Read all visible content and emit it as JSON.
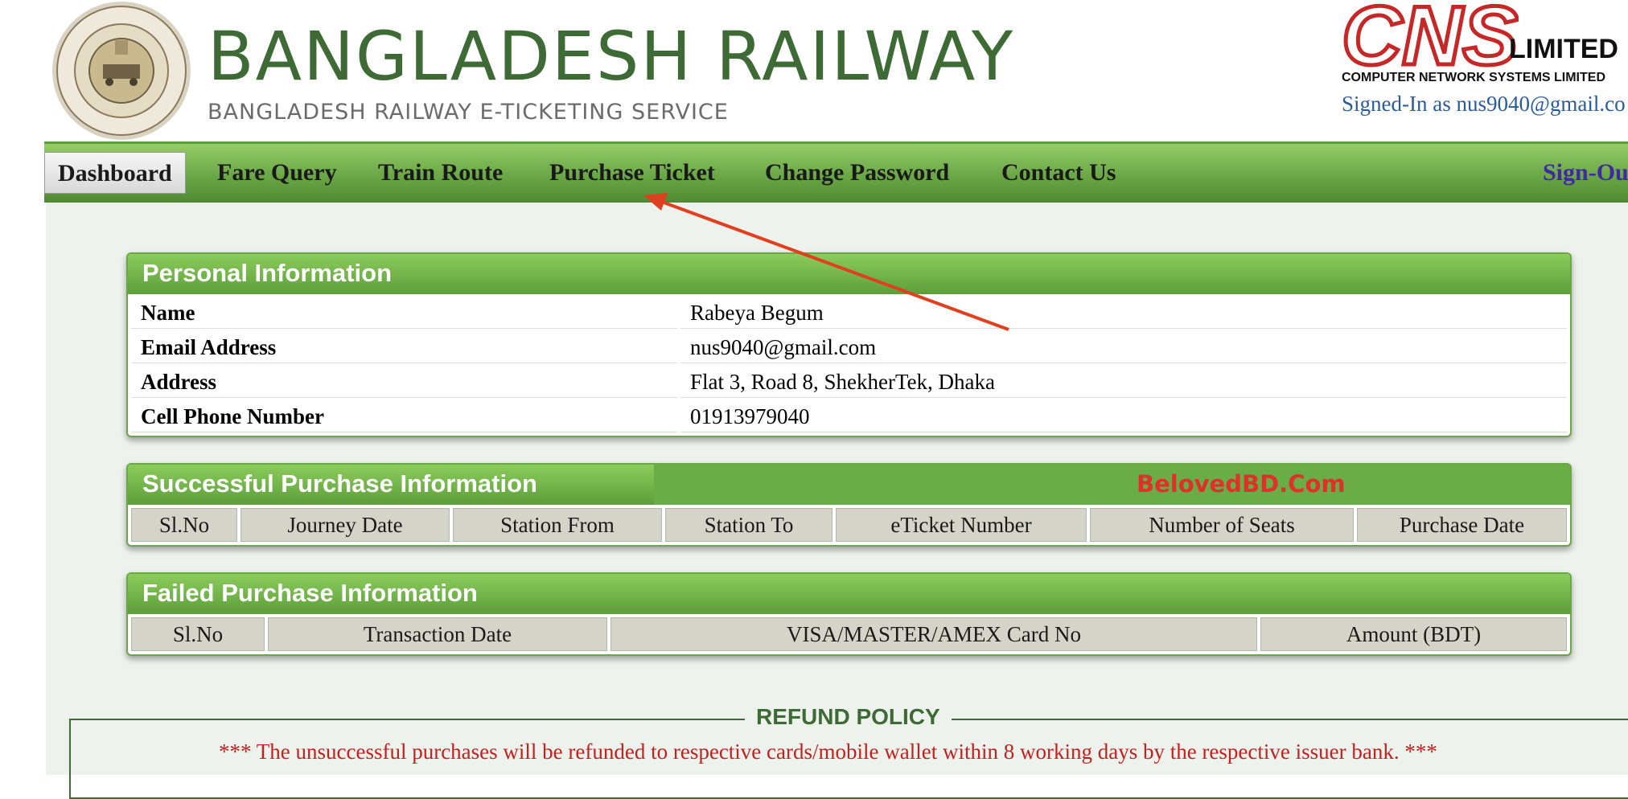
{
  "header": {
    "title": "BANGLADESH RAILWAY",
    "subtitle": "BANGLADESH RAILWAY E-TICKETING SERVICE",
    "partner": {
      "brand": "CNS",
      "limited": "LIMITED",
      "full_name": "COMPUTER NETWORK SYSTEMS LIMITED"
    },
    "signed_in": "Signed-In as nus9040@gmail.co"
  },
  "nav": {
    "items": [
      {
        "label": "Dashboard",
        "active": true
      },
      {
        "label": "Fare Query"
      },
      {
        "label": "Train Route"
      },
      {
        "label": "Purchase Ticket"
      },
      {
        "label": "Change Password"
      },
      {
        "label": "Contact Us"
      }
    ],
    "sign_out": "Sign-Ou"
  },
  "personal": {
    "title": "Personal Information",
    "rows": [
      {
        "label": "Name",
        "value": "Rabeya Begum"
      },
      {
        "label": "Email Address",
        "value": "nus9040@gmail.com"
      },
      {
        "label": "Address",
        "value": "Flat 3, Road 8, ShekherTek, Dhaka"
      },
      {
        "label": "Cell Phone Number",
        "value": "01913979040"
      }
    ]
  },
  "successful": {
    "title": "Successful Purchase Information",
    "watermark": "BelovedBD.Com",
    "columns": [
      "Sl.No",
      "Journey Date",
      "Station From",
      "Station To",
      "eTicket Number",
      "Number of Seats",
      "Purchase Date"
    ]
  },
  "failed": {
    "title": "Failed Purchase Information",
    "columns": [
      "Sl.No",
      "Transaction Date",
      "VISA/MASTER/AMEX Card No",
      "Amount (BDT)"
    ]
  },
  "refund": {
    "title": "REFUND POLICY",
    "text": "*** The unsuccessful purchases will be refunded to respective cards/mobile wallet within 8 working days by the respective issuer bank. ***"
  },
  "colors": {
    "brand_green": "#3d6a35",
    "nav_green": "#6aa746",
    "annotation_red": "#e0401f"
  }
}
